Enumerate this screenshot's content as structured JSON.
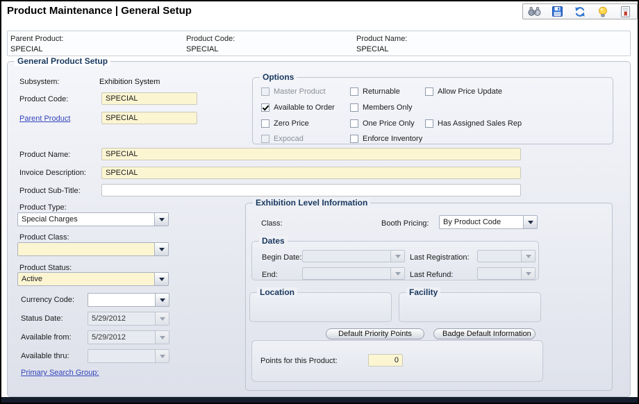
{
  "window_title": "Product Maintenance  |  General Setup",
  "toolbar": {
    "icons": [
      "binoculars-search",
      "save",
      "refresh",
      "tip-lightbulb",
      "report"
    ]
  },
  "header": {
    "fields": [
      {
        "label": "Parent Product:",
        "value": "SPECIAL"
      },
      {
        "label": "Product Code:",
        "value": "SPECIAL"
      },
      {
        "label": "Product Name:",
        "value": "SPECIAL"
      }
    ]
  },
  "general": {
    "legend": "General Product Setup",
    "subsystem": {
      "label": "Subsystem:",
      "value": "Exhibition System"
    },
    "product_code": {
      "label": "Product Code:",
      "value": "SPECIAL"
    },
    "parent_product": {
      "link": "Parent Product",
      "value": "SPECIAL"
    },
    "options": {
      "legend": "Options",
      "items": [
        {
          "label": "Master Product",
          "checked": false,
          "disabled": true
        },
        {
          "label": "Returnable",
          "checked": false,
          "disabled": false
        },
        {
          "label": "Allow Price Update",
          "checked": false,
          "disabled": false
        },
        {
          "label": "Available to Order",
          "checked": true,
          "disabled": false
        },
        {
          "label": "Members Only",
          "checked": false,
          "disabled": false
        },
        {
          "label": "Zero Price",
          "checked": false,
          "disabled": false
        },
        {
          "label": "One Price Only",
          "checked": false,
          "disabled": false
        },
        {
          "label": "Has Assigned Sales Rep",
          "checked": false,
          "disabled": false
        },
        {
          "label": "Expocad",
          "checked": false,
          "disabled": true
        },
        {
          "label": "Enforce Inventory",
          "checked": false,
          "disabled": false
        }
      ]
    },
    "product_name": {
      "label": "Product Name:",
      "value": "SPECIAL"
    },
    "invoice_description": {
      "label": "Invoice Description:",
      "value": "SPECIAL"
    },
    "product_sub_title": {
      "label": "Product Sub-Title:",
      "value": ""
    },
    "product_type": {
      "label": "Product Type:",
      "value": "Special Charges"
    },
    "product_class": {
      "label": "Product Class:",
      "value": ""
    },
    "product_status": {
      "label": "Product Status:",
      "value": "Active"
    },
    "currency_code": {
      "label": "Currency Code:",
      "value": ""
    },
    "status_date": {
      "label": "Status Date:",
      "value": "5/29/2012"
    },
    "available_from": {
      "label": "Available from:",
      "value": "5/29/2012"
    },
    "available_thru": {
      "label": "Available thru:",
      "value": ""
    },
    "primary_search_group_link": "Primary Search Group:"
  },
  "exhibition": {
    "legend": "Exhibition Level Information",
    "class_label": "Class:",
    "booth_pricing": {
      "label": "Booth Pricing:",
      "value": "By Product Code"
    },
    "dates": {
      "legend": "Dates",
      "begin_date_label": "Begin Date:",
      "last_registration_label": "Last Registration:",
      "end_label": "End:",
      "last_refund_label": "Last Refund:"
    },
    "location_legend": "Location",
    "facility_legend": "Facility",
    "default_priority_points_button": "Default Priority Points",
    "badge_default_information_button": "Badge Default Information",
    "points": {
      "label": "Points for this Product:",
      "value": "0"
    }
  },
  "colors": {
    "legend_navy": "#17375e",
    "field_highlight_yellow": "#fcf5d2",
    "link_blue": "#3344bb",
    "bottom_bar_navy": "#151c2c"
  }
}
